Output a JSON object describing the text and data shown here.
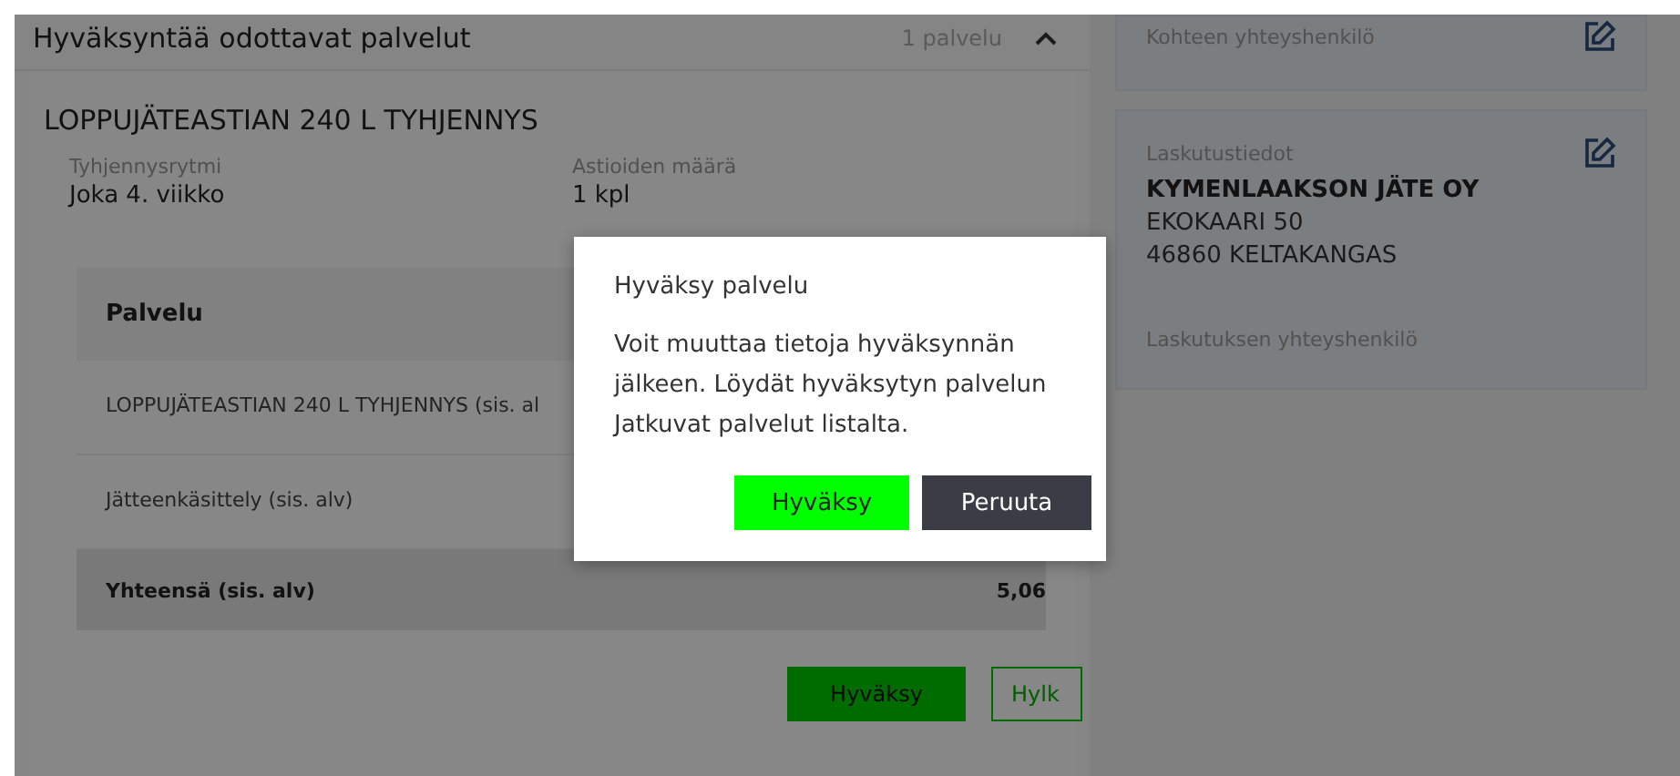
{
  "pending": {
    "title": "Hyväksyntää odottavat palvelut",
    "count": "1 palvelu",
    "expanded": true,
    "service": {
      "title": "LOPPUJÄTEASTIAN 240 L TYHJENNYS",
      "fields": [
        {
          "label": "Tyhjennysrytmi",
          "value": "Joka 4. viikko"
        },
        {
          "label": "Astioiden määrä",
          "value": "1 kpl"
        }
      ],
      "table": {
        "header": "Palvelu",
        "rows": [
          {
            "label": "LOPPUJÄTEASTIAN 240 L TYHJENNYS (sis. al"
          },
          {
            "label": "Jätteenkäsittely (sis. alv)"
          }
        ],
        "total": {
          "label": "Yhteensä (sis. alv)",
          "value": "5,06"
        }
      },
      "buttons": [
        {
          "label": "Hyväksy",
          "kind": "primary"
        },
        {
          "label": "Hylk",
          "kind": "outline"
        }
      ]
    }
  },
  "sidebar": [
    {
      "title": "Kohteen yhteyshenkilö"
    },
    {
      "title": "Laskutustiedot",
      "lines": [
        {
          "text": "KYMENLAAKSON JÄTE OY",
          "kind": "name"
        },
        {
          "text": "EKOKAARI 50",
          "kind": "line"
        },
        {
          "text": "46860 KELTAKANGAS",
          "kind": "line"
        }
      ],
      "subtitle": "Laskutuksen yhteyshenkilö"
    }
  ],
  "dialog": {
    "title": "Hyväksy palvelu",
    "message": "Voit muuttaa tietoja hyväksynnän jälkeen. Löydät hyväksytyn palvelun Jatkuvat palvelut listalta.",
    "buttons": [
      {
        "label": "Hyväksy",
        "kind": "primary"
      },
      {
        "label": "Peruuta",
        "kind": "dark"
      }
    ]
  }
}
